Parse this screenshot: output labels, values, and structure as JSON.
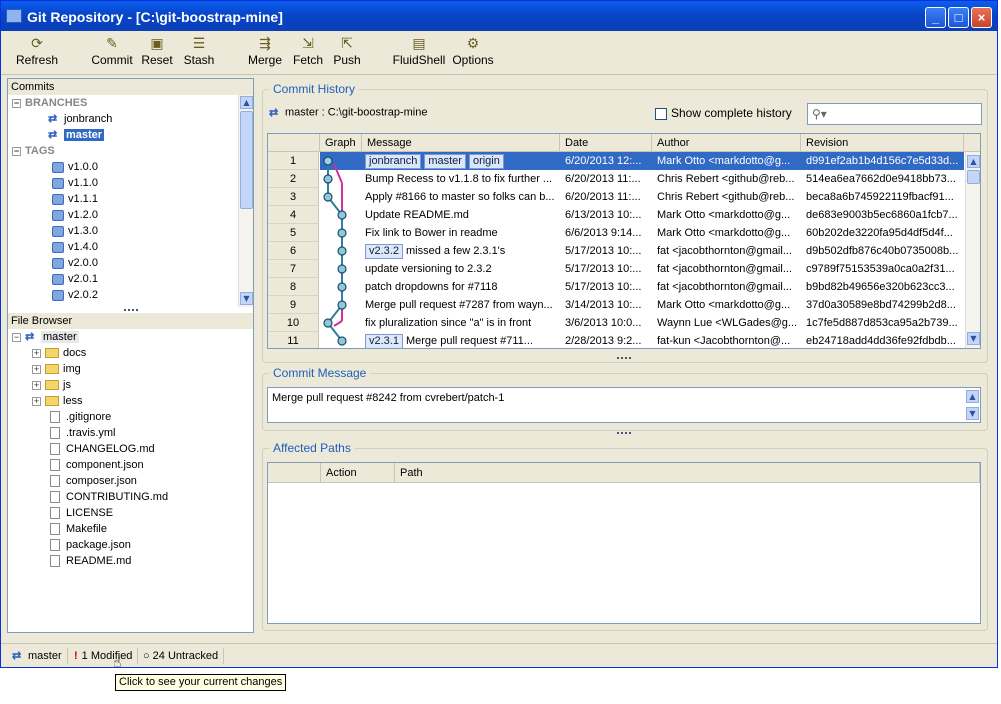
{
  "window": {
    "title": "Git Repository - [C:\\git-boostrap-mine]"
  },
  "toolbar": {
    "refresh": "Refresh",
    "commit": "Commit",
    "reset": "Reset",
    "stash": "Stash",
    "merge": "Merge",
    "fetch": "Fetch",
    "push": "Push",
    "fluidshell": "FluidShell",
    "options": "Options"
  },
  "commits_panel": {
    "title": "Commits",
    "branches_label": "BRANCHES",
    "branches": [
      "jonbranch",
      "master"
    ],
    "tags_label": "TAGS",
    "tags": [
      "v1.0.0",
      "v1.1.0",
      "v1.1.1",
      "v1.2.0",
      "v1.3.0",
      "v1.4.0",
      "v2.0.0",
      "v2.0.1",
      "v2.0.2"
    ]
  },
  "file_browser": {
    "title": "File Browser",
    "root": "master",
    "folders": [
      "docs",
      "img",
      "js",
      "less"
    ],
    "files": [
      ".gitignore",
      ".travis.yml",
      "CHANGELOG.md",
      "component.json",
      "composer.json",
      "CONTRIBUTING.md",
      "LICENSE",
      "Makefile",
      "package.json",
      "README.md"
    ]
  },
  "history": {
    "title": "Commit History",
    "context": "master : C:\\git-boostrap-mine",
    "show_complete_label": "Show complete history",
    "search_placeholder": "",
    "columns": [
      "Graph",
      "Message",
      "Date",
      "Author",
      "Revision"
    ],
    "rows": [
      {
        "num": "1",
        "badges": [
          "jonbranch",
          "master",
          "origin"
        ],
        "message": "",
        "date": "6/20/2013 12:...",
        "author": "Mark Otto <markdotto@g...",
        "revision": "d991ef2ab1b4d156c7e5d33d..."
      },
      {
        "num": "2",
        "badges": [],
        "message": "Bump Recess to v1.1.8 to fix further ...",
        "date": "6/20/2013 11:...",
        "author": "Chris Rebert <github@reb...",
        "revision": "514ea6ea7662d0e9418bb73..."
      },
      {
        "num": "3",
        "badges": [],
        "message": "Apply #8166 to master so folks can b...",
        "date": "6/20/2013 11:...",
        "author": "Chris Rebert <github@reb...",
        "revision": "beca8a6b745922119fbacf91..."
      },
      {
        "num": "4",
        "badges": [],
        "message": "Update README.md",
        "date": "6/13/2013 10:...",
        "author": "Mark Otto <markdotto@g...",
        "revision": "de683e9003b5ec6860a1fcb7..."
      },
      {
        "num": "5",
        "badges": [],
        "message": "Fix link to Bower in readme",
        "date": "6/6/2013 9:14...",
        "author": "Mark Otto <markdotto@g...",
        "revision": "60b202de3220fa95d4df5d4f..."
      },
      {
        "num": "6",
        "badges": [
          "v2.3.2"
        ],
        "message": "missed a few 2.3.1's",
        "date": "5/17/2013 10:...",
        "author": "fat <jacobthornton@gmail...",
        "revision": "d9b502dfb876c40b0735008b..."
      },
      {
        "num": "7",
        "badges": [],
        "message": "update versioning to 2.3.2",
        "date": "5/17/2013 10:...",
        "author": "fat <jacobthornton@gmail...",
        "revision": "c9789f75153539a0ca0a2f31..."
      },
      {
        "num": "8",
        "badges": [],
        "message": "patch dropdowns for #7118",
        "date": "5/17/2013 10:...",
        "author": "fat <jacobthornton@gmail...",
        "revision": "b9bd82b49656e320b623cc3..."
      },
      {
        "num": "9",
        "badges": [],
        "message": "Merge pull request #7287 from wayn...",
        "date": "3/14/2013 10:...",
        "author": "Mark Otto <markdotto@g...",
        "revision": "37d0a30589e8bd74299b2d8..."
      },
      {
        "num": "10",
        "badges": [],
        "message": "fix pluralization since \"a\" is in front",
        "date": "3/6/2013 10:0...",
        "author": "Waynn Lue <WLGades@g...",
        "revision": "1c7fe5d887d853ca95a2b739..."
      },
      {
        "num": "11",
        "badges": [
          "v2.3.1"
        ],
        "message": "Merge pull request #711...",
        "date": "2/28/2013 9:2...",
        "author": "fat-kun <Jacobthornton@...",
        "revision": "eb24718add4dd36fe92fdbdb..."
      }
    ]
  },
  "commit_message": {
    "title": "Commit Message",
    "text": "Merge pull request #8242 from cvrebert/patch-1"
  },
  "affected_paths": {
    "title": "Affected Paths",
    "columns": [
      "Action",
      "Path"
    ]
  },
  "status_bar": {
    "branch": "master",
    "modified": "1 Modified",
    "untracked": "24 Untracked"
  },
  "tooltip": "Click to see your current changes",
  "colors": {
    "selection": "#316ac5",
    "title_accent": "#1f5fbf",
    "graph_line": "#2f7fa0",
    "graph_branch": "#d0309a"
  }
}
